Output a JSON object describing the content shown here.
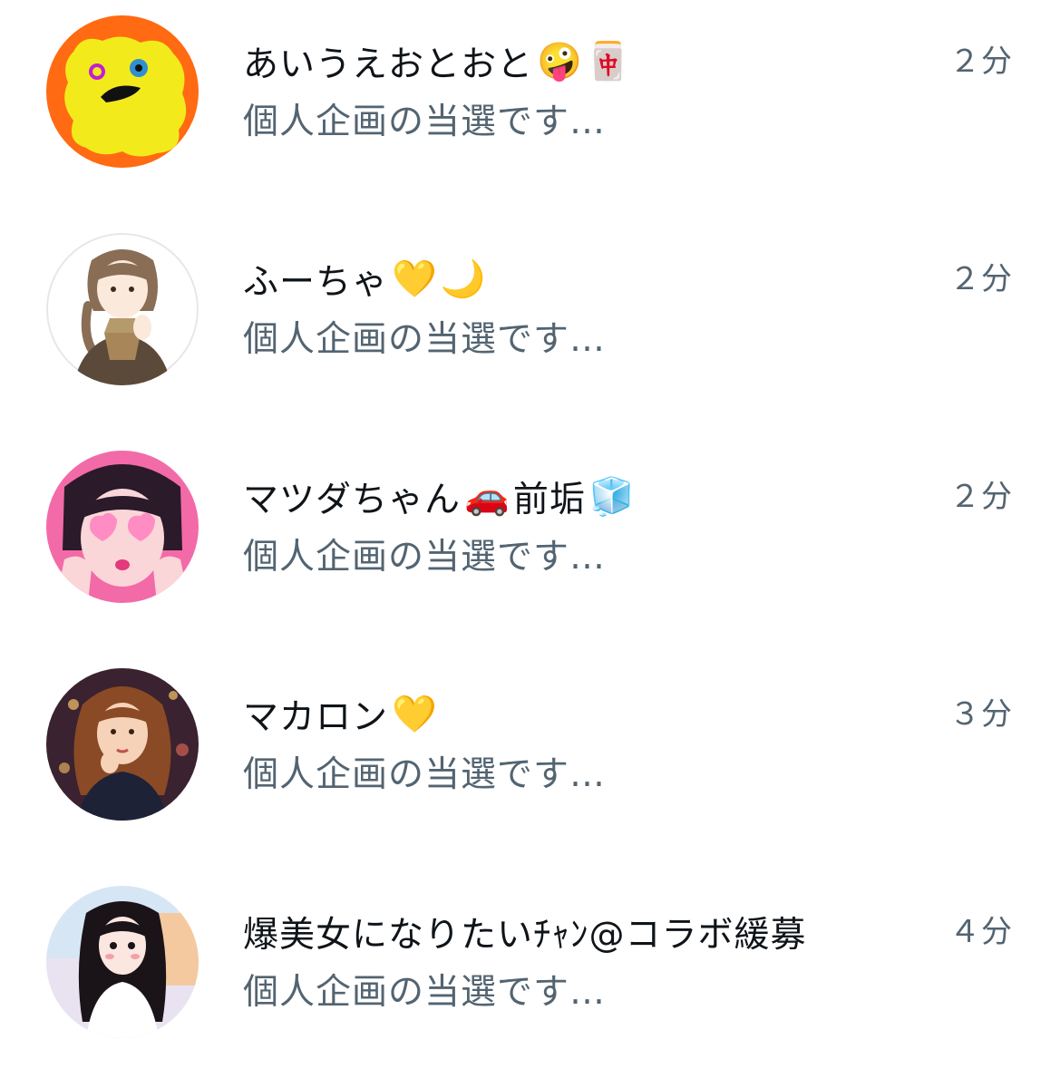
{
  "notifications": [
    {
      "avatar": "yellow-sponge-creature-avatar",
      "name": "あいうえおとおと",
      "emojis": [
        "🤪",
        "🀄"
      ],
      "name_suffix": "",
      "preview": "個人企画の当選です…",
      "time": "２分"
    },
    {
      "avatar": "illustrated-woman-braids-avatar",
      "name": "ふーちゃ",
      "emojis": [
        "💛",
        "🌙"
      ],
      "name_suffix": "",
      "preview": "個人企画の当選です…",
      "time": "２分"
    },
    {
      "avatar": "pink-heart-glasses-girl-avatar",
      "name": "マツダちゃん",
      "emojis": [
        "🚗"
      ],
      "name_suffix": "前垢",
      "emojis_after": [
        "🧊"
      ],
      "preview": "個人企画の当選です…",
      "time": "２分"
    },
    {
      "avatar": "wavy-hair-woman-night-avatar",
      "name": "マカロン",
      "emojis": [
        "💛"
      ],
      "name_suffix": "",
      "preview": "個人企画の当選です…",
      "time": "３分"
    },
    {
      "avatar": "black-hair-girl-avatar",
      "name": "爆美女になりたいﾁｬﾝ@コラボ緩募",
      "emojis": [],
      "name_suffix": "",
      "preview": "個人企画の当選です…",
      "time": "４分"
    }
  ]
}
